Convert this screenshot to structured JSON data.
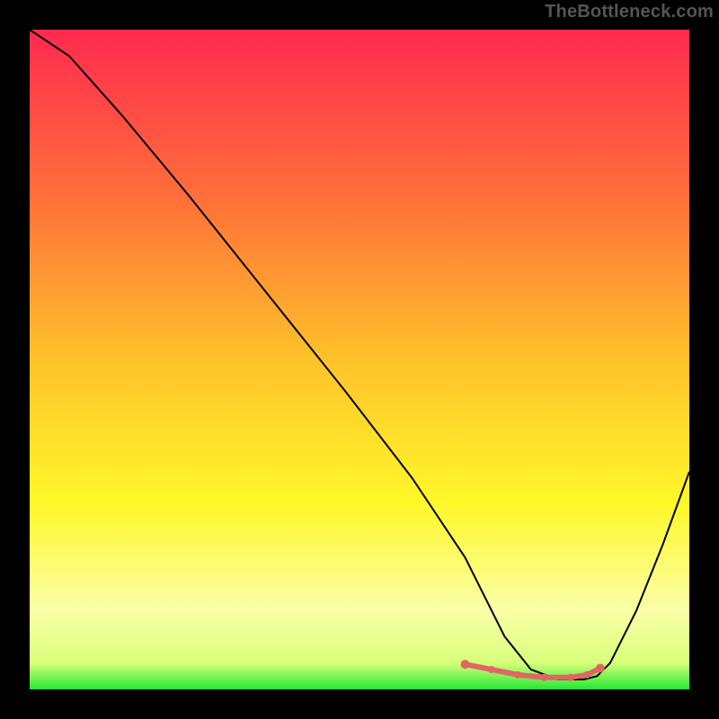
{
  "watermark": "TheBottleneck.com",
  "chart_data": {
    "type": "line",
    "title": "",
    "xlabel": "",
    "ylabel": "",
    "xlim": [
      0,
      100
    ],
    "ylim": [
      0,
      100
    ],
    "grid": false,
    "legend": false,
    "gradient_stops": [
      {
        "offset": 0,
        "color": "#ff2a4f"
      },
      {
        "offset": 25,
        "color": "#ff6e3a"
      },
      {
        "offset": 50,
        "color": "#ffc22a"
      },
      {
        "offset": 72,
        "color": "#fff82a"
      },
      {
        "offset": 88,
        "color": "#faffa8"
      },
      {
        "offset": 96,
        "color": "#d8ff7a"
      },
      {
        "offset": 100,
        "color": "#27e833"
      }
    ],
    "series": [
      {
        "name": "bottleneck-curve",
        "color": "#000000",
        "x": [
          0,
          6,
          14,
          24,
          36,
          48,
          58,
          66,
          70,
          72,
          76,
          80,
          84,
          86,
          88,
          92,
          96,
          100
        ],
        "values": [
          100,
          96,
          87,
          75,
          60,
          45,
          32,
          20,
          12,
          8,
          3,
          1.5,
          1.5,
          2,
          4,
          12,
          22,
          33
        ]
      }
    ],
    "highlight_segments": [
      {
        "x": [
          66,
          70
        ],
        "y": [
          3.8,
          3.0
        ],
        "color": "#e06666",
        "width": 6
      },
      {
        "x": [
          70,
          74
        ],
        "y": [
          3.0,
          2.2
        ],
        "color": "#e06666",
        "width": 6
      },
      {
        "x": [
          74,
          78
        ],
        "y": [
          2.2,
          1.8
        ],
        "color": "#e06666",
        "width": 6
      },
      {
        "x": [
          78,
          82
        ],
        "y": [
          1.8,
          1.8
        ],
        "color": "#e06666",
        "width": 6
      },
      {
        "x": [
          82,
          84.5
        ],
        "y": [
          1.8,
          2.2
        ],
        "color": "#e06666",
        "width": 6
      },
      {
        "x": [
          84.5,
          86.5
        ],
        "y": [
          2.2,
          3.2
        ],
        "color": "#e06666",
        "width": 6
      }
    ],
    "highlight_points": [
      {
        "x": 66,
        "y": 3.8,
        "r": 5,
        "color": "#e06666"
      },
      {
        "x": 70,
        "y": 3.0,
        "r": 4,
        "color": "#e06666"
      },
      {
        "x": 74,
        "y": 2.2,
        "r": 4,
        "color": "#e06666"
      },
      {
        "x": 78,
        "y": 1.8,
        "r": 4,
        "color": "#e06666"
      },
      {
        "x": 82,
        "y": 1.8,
        "r": 4,
        "color": "#e06666"
      },
      {
        "x": 84.5,
        "y": 2.2,
        "r": 4,
        "color": "#e06666"
      },
      {
        "x": 86.5,
        "y": 3.2,
        "r": 5,
        "color": "#e06666"
      }
    ]
  }
}
